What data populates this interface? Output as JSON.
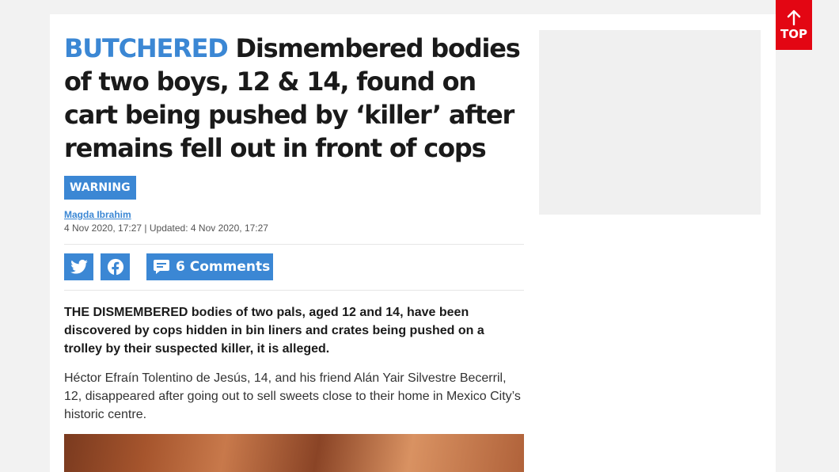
{
  "article": {
    "kicker": "BUTCHERED",
    "headline": "Dismembered bodies of two boys, 12 & 14, found on cart being pushed by ‘killer’ after remains fell out in front of cops",
    "warning_label": "WARNING",
    "author": "Magda Ibrahim",
    "dateline": "4 Nov 2020, 17:27 | Updated: 4 Nov 2020, 17:27",
    "standfirst": "THE DISMEMBERED bodies of two pals, aged 12 and 14, have been discovered by cops hidden in bin liners and crates being pushed on a trolley by their suspected killer, it is alleged.",
    "paragraph_1": "Héctor Efraín Tolentino de Jesús, 14, and his friend Alán Yair Silvestre Becerril, 12, disappeared after going out to sell sweets close to their home in Mexico City’s historic centre."
  },
  "share": {
    "twitter_icon": "twitter-bird-icon",
    "facebook_icon": "facebook-f-icon",
    "comments_label": "6 Comments",
    "comments_icon": "speech-bubble-icon"
  },
  "top_button": {
    "label": "TOP",
    "icon": "arrow-up-icon"
  },
  "colors": {
    "accent": "#3b87d4",
    "top_button": "#e30613",
    "headline": "#1a1a1a"
  }
}
